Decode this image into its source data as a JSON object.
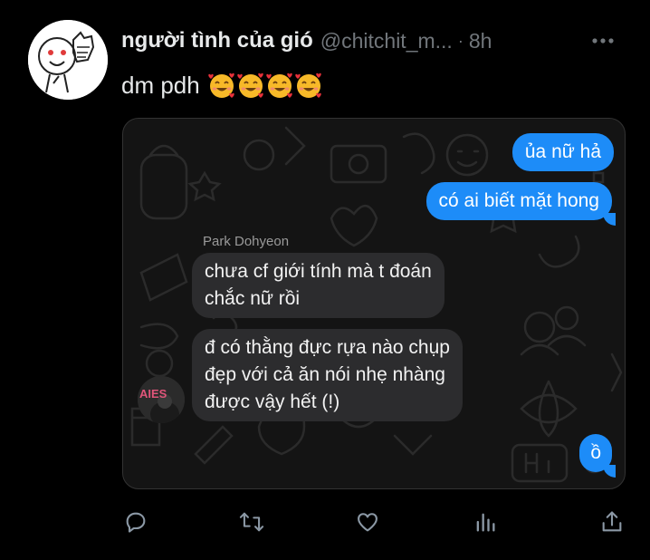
{
  "tweet": {
    "author_name": "người tình của gió",
    "author_handle": "@chitchit_m...",
    "separator": "·",
    "time": "8h",
    "text": "dm pdh",
    "emoji_icons": [
      "smiling-face-with-hearts-icon",
      "smiling-face-with-hearts-icon",
      "smiling-face-with-hearts-icon",
      "smiling-face-with-hearts-icon"
    ]
  },
  "chat": {
    "messages": [
      {
        "direction": "outgoing",
        "text": "ủa nữ hả"
      },
      {
        "direction": "outgoing",
        "text": "có ai biết mặt hong"
      },
      {
        "direction": "incoming",
        "sender": "Park Dohyeon",
        "lines": [
          "chưa cf giới tính mà t đoán",
          "chắc nữ rồi"
        ]
      },
      {
        "direction": "incoming",
        "lines": [
          "đ có thằng đực rựa nào chụp",
          "đẹp với cả ăn nói nhẹ nhàng",
          "được vậy hết (!)"
        ]
      },
      {
        "direction": "outgoing",
        "text": "ồ"
      }
    ],
    "avatar_text": "AIES"
  },
  "actions": [
    "reply-icon",
    "retweet-icon",
    "like-icon",
    "analytics-icon",
    "share-icon"
  ],
  "colors": {
    "background": "#000000",
    "outgoing_bubble": "#1d8cf8",
    "incoming_bubble": "#2c2c2e",
    "muted_text": "#71767b",
    "action_icon": "#8b98a5"
  }
}
